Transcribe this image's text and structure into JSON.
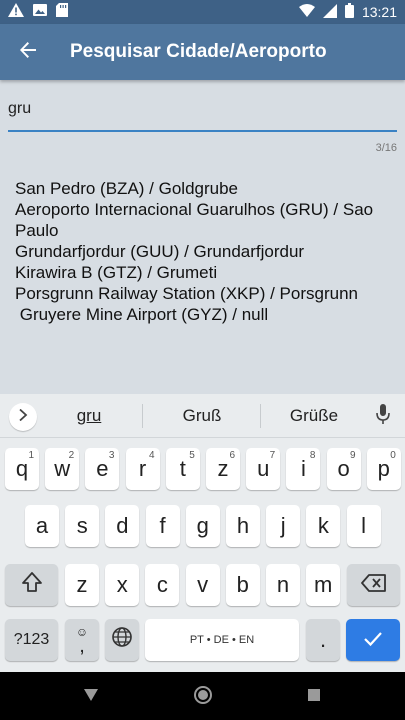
{
  "status_bar": {
    "time": "13:21",
    "icons": [
      "warning-icon",
      "image-icon",
      "sd-card-icon",
      "wifi-icon",
      "signal-icon",
      "battery-icon"
    ]
  },
  "app_bar": {
    "title": "Pesquisar Cidade/Aeroporto",
    "back_icon": "arrow-back-icon"
  },
  "search": {
    "value": "gru",
    "counter": "3/16"
  },
  "results": [
    "San Pedro (BZA) / Goldgrube",
    "Aeroporto Internacional Guarulhos (GRU) / Sao Paulo",
    "Grundarfjordur (GUU) / Grundarfjordur",
    "Kirawira B (GTZ) / Grumeti",
    "Porsgrunn Railway Station (XKP) / Porsgrunn",
    " Gruyere Mine Airport (GYZ) / null"
  ],
  "keyboard": {
    "suggestions": [
      "gru",
      "Gruß",
      "Grüße"
    ],
    "row1": [
      {
        "k": "q",
        "h": "1"
      },
      {
        "k": "w",
        "h": "2"
      },
      {
        "k": "e",
        "h": "3"
      },
      {
        "k": "r",
        "h": "4"
      },
      {
        "k": "t",
        "h": "5"
      },
      {
        "k": "z",
        "h": "6"
      },
      {
        "k": "u",
        "h": "7"
      },
      {
        "k": "i",
        "h": "8"
      },
      {
        "k": "o",
        "h": "9"
      },
      {
        "k": "p",
        "h": "0"
      }
    ],
    "row2": [
      "a",
      "s",
      "d",
      "f",
      "g",
      "h",
      "j",
      "k",
      "l"
    ],
    "row3": [
      "z",
      "x",
      "c",
      "v",
      "b",
      "n",
      "m"
    ],
    "symbols_label": "?123",
    "emoji_top": "☺",
    "comma": ",",
    "space_label": "PT • DE • EN",
    "period": ".",
    "colors": {
      "enter": "#2e7ce4",
      "app_bar": "#4f769e",
      "status_bar": "#3e6186"
    }
  },
  "nav_bar": {
    "icons": [
      "back-triangle-icon",
      "home-circle-icon",
      "recents-square-icon"
    ]
  }
}
